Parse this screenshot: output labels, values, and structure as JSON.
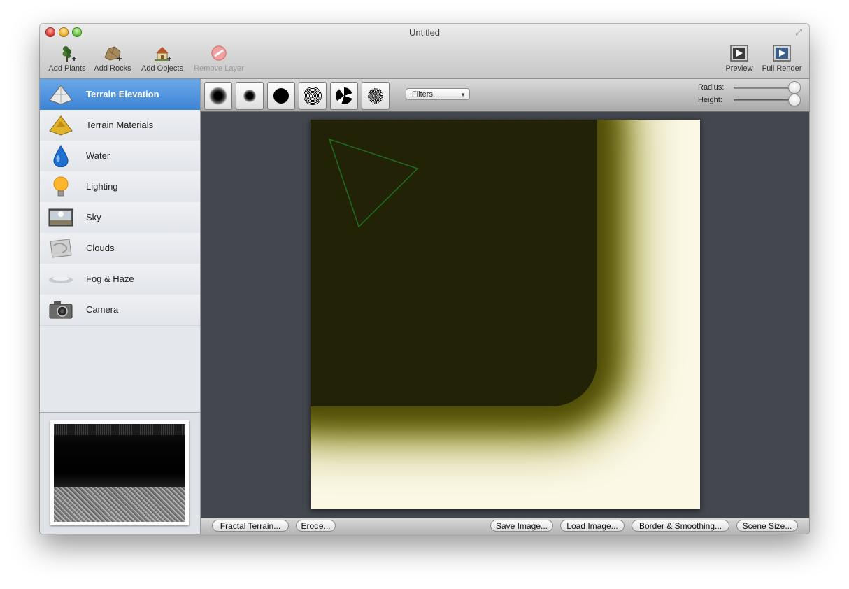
{
  "window": {
    "title": "Untitled",
    "fullscreen_icon": "fullscreen-arrows-icon"
  },
  "toolbar": {
    "add_plants": {
      "label": "Add Plants",
      "icon": "plant-add-icon"
    },
    "add_rocks": {
      "label": "Add Rocks",
      "icon": "rock-add-icon"
    },
    "add_objects": {
      "label": "Add Objects",
      "icon": "house-add-icon"
    },
    "remove_layer": {
      "label": "Remove Layer",
      "icon": "remove-icon",
      "enabled": false
    },
    "preview": {
      "label": "Preview",
      "icon": "play-preview-icon"
    },
    "full_render": {
      "label": "Full Render",
      "icon": "render-icon"
    }
  },
  "sidebar": {
    "items": [
      {
        "label": "Terrain Elevation",
        "icon": "terrain-elevation-icon",
        "selected": true
      },
      {
        "label": "Terrain Materials",
        "icon": "terrain-materials-icon",
        "selected": false
      },
      {
        "label": "Water",
        "icon": "water-drop-icon",
        "selected": false
      },
      {
        "label": "Lighting",
        "icon": "light-bulb-icon",
        "selected": false
      },
      {
        "label": "Sky",
        "icon": "sky-icon",
        "selected": false
      },
      {
        "label": "Clouds",
        "icon": "clouds-icon",
        "selected": false
      },
      {
        "label": "Fog & Haze",
        "icon": "fog-icon",
        "selected": false
      },
      {
        "label": "Camera",
        "icon": "camera-icon",
        "selected": false
      }
    ]
  },
  "brushes": [
    {
      "name": "soft-round-large-brush"
    },
    {
      "name": "soft-round-small-brush"
    },
    {
      "name": "hard-round-brush"
    },
    {
      "name": "noise-brush"
    },
    {
      "name": "swirl-brush"
    },
    {
      "name": "splatter-brush"
    }
  ],
  "filters": {
    "label": "Filters..."
  },
  "sliders": {
    "radius": {
      "label": "Radius:",
      "value": 1.0
    },
    "height": {
      "label": "Height:",
      "value": 1.0
    }
  },
  "bottom_buttons": {
    "fractal_terrain": "Fractal Terrain...",
    "erode": "Erode...",
    "save_image": "Save Image...",
    "load_image": "Load Image...",
    "border_smoothing": "Border & Smoothing...",
    "scene_size": "Scene Size..."
  },
  "colors": {
    "selection": "#3d84d6",
    "terrain_low": "#222206",
    "terrain_mid": "#8f8d15",
    "terrain_high": "#fbf8e6",
    "camera_marker": "#1f6a1f"
  }
}
